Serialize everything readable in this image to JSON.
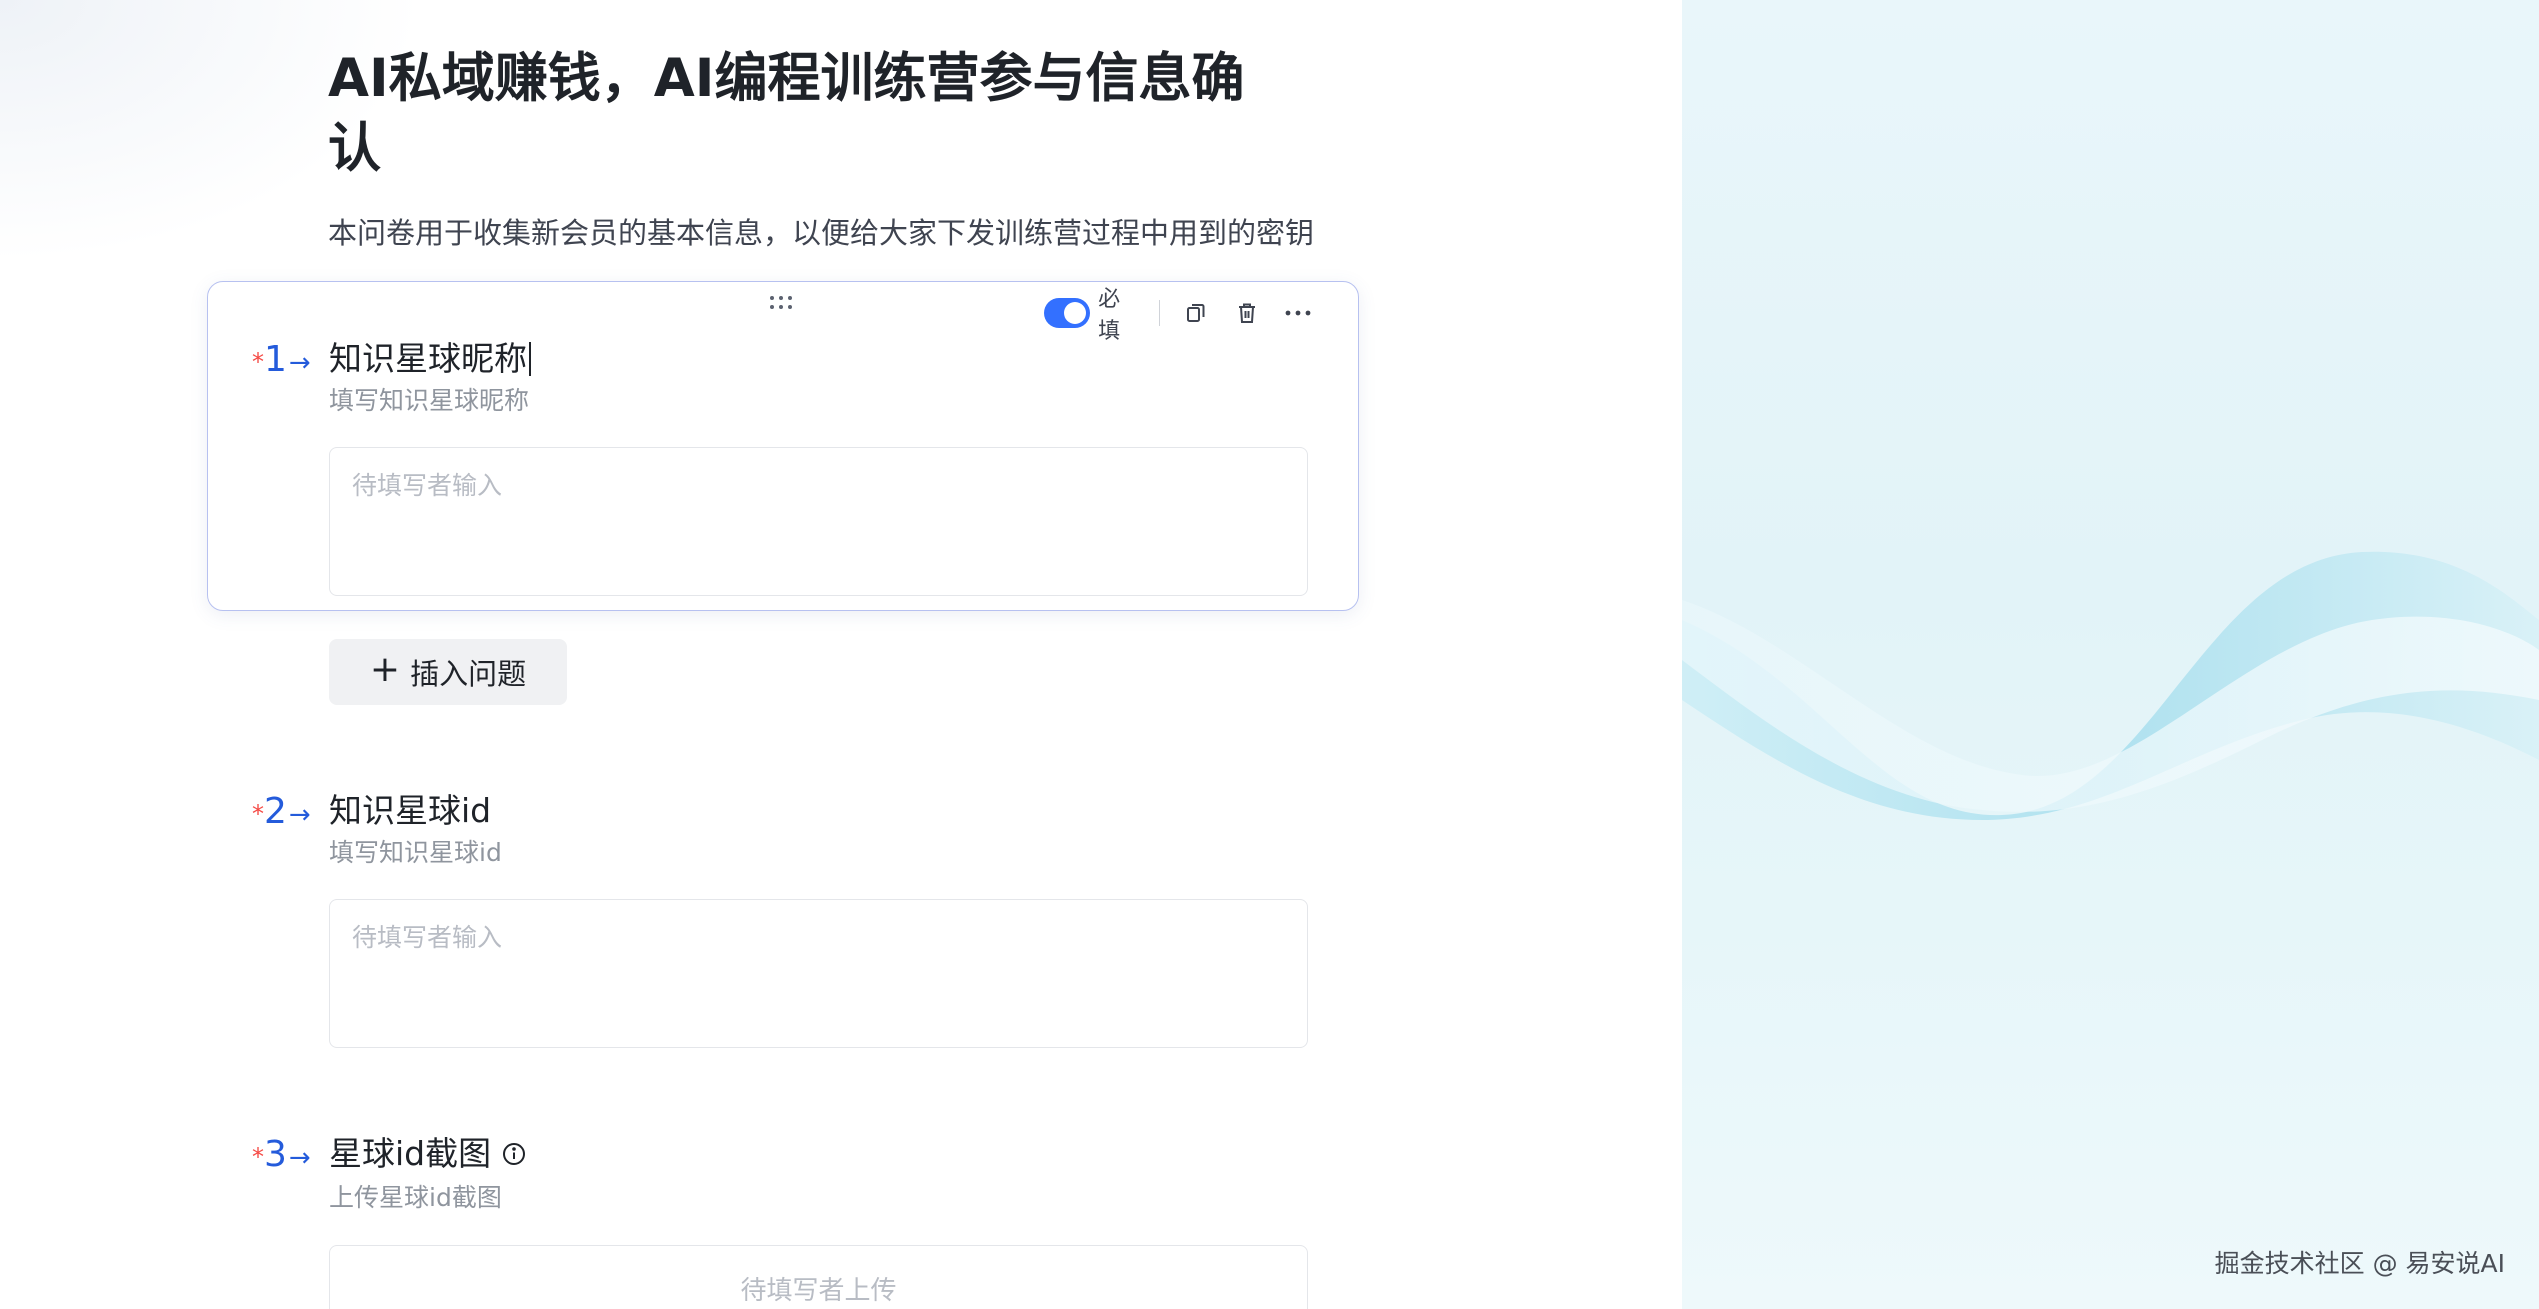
{
  "form": {
    "title": "AI私域赚钱，AI编程训练营参与信息确认",
    "description": "本问卷用于收集新会员的基本信息，以便给大家下发训练营过程中用到的密钥"
  },
  "toolbar": {
    "required_label": "必填",
    "required_on": true
  },
  "questions": [
    {
      "number": "1",
      "title": "知识星球昵称",
      "subtitle": "填写知识星球昵称",
      "placeholder": "待填写者输入"
    },
    {
      "number": "2",
      "title": "知识星球id",
      "subtitle": "填写知识星球id",
      "placeholder": "待填写者输入"
    },
    {
      "number": "3",
      "title": "星球id截图",
      "subtitle": "上传星球id截图",
      "placeholder": "待填写者上传"
    }
  ],
  "insert_button": {
    "label": "插入问题"
  },
  "required_mark": "*",
  "arrow_glyph": "→",
  "watermark": "掘金技术社区 @ 易安说AI",
  "colors": {
    "accent": "#3370ff",
    "required": "#f54a45",
    "number": "#245bdb"
  }
}
